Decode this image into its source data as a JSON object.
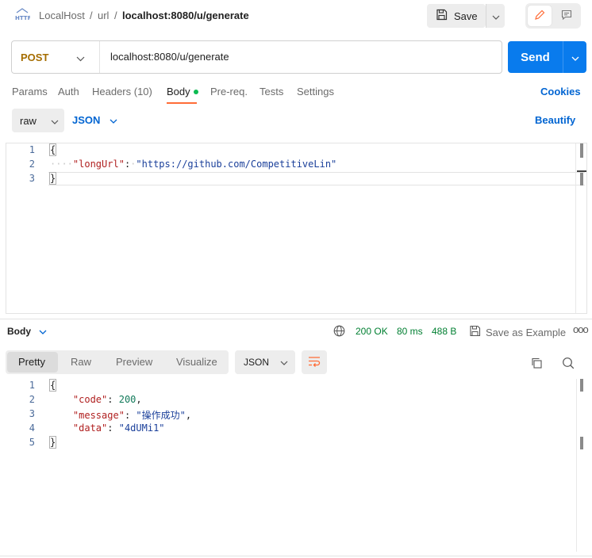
{
  "header": {
    "breadcrumb": [
      "LocalHost",
      "/",
      "url",
      "/",
      "localhost:8080/u/generate"
    ],
    "save_label": "Save"
  },
  "request": {
    "method": "POST",
    "url": "localhost:8080/u/generate",
    "send_label": "Send",
    "tabs": [
      "Params",
      "Auth",
      "Headers (10)",
      "Body",
      "Pre-req.",
      "Tests",
      "Settings"
    ],
    "active_tab": "Body",
    "cookies_label": "Cookies",
    "body_type": "raw",
    "body_language": "JSON",
    "beautify_label": "Beautify",
    "body_lines": [
      {
        "num": "1"
      },
      {
        "num": "2",
        "key": "\"longUrl\"",
        "value": "\"https://github.com/CompetitiveLin\""
      },
      {
        "num": "3"
      }
    ]
  },
  "response": {
    "body_label": "Body",
    "status": "200 OK",
    "time": "80 ms",
    "size": "488 B",
    "save_example_label": "Save as Example",
    "view_tabs": [
      "Pretty",
      "Raw",
      "Preview",
      "Visualize"
    ],
    "active_view": "Pretty",
    "format": "JSON",
    "lines": [
      {
        "num": "1"
      },
      {
        "num": "2",
        "key": "\"code\"",
        "value": "200"
      },
      {
        "num": "3",
        "key": "\"message\"",
        "value": "\"操作成功\""
      },
      {
        "num": "4",
        "key": "\"data\"",
        "value": "\"4dUMi1\""
      },
      {
        "num": "5"
      }
    ]
  },
  "colors": {
    "accent": "#097bed",
    "tab_underline": "#ff6c37",
    "method": "#a56d00",
    "status_ok": "#007f31"
  }
}
